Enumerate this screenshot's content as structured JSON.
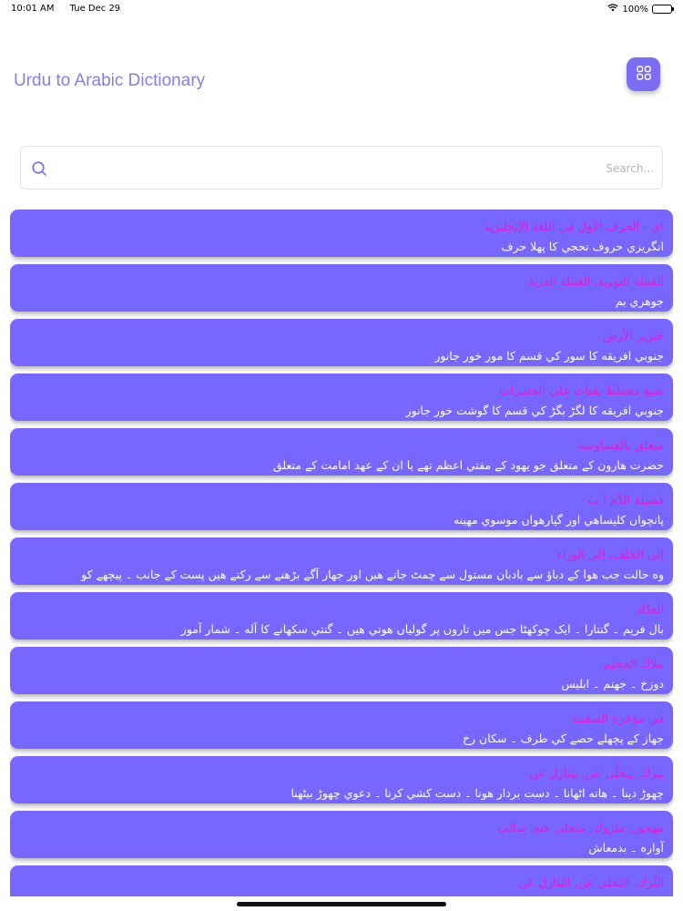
{
  "status_bar": {
    "time": "10:01 AM",
    "date": "Tue Dec 29",
    "battery": "100%",
    "wifi_icon": "wifi-icon",
    "battery_icon": "battery-icon"
  },
  "header": {
    "title": "Urdu to Arabic Dictionary",
    "menu_icon": "grid-icon"
  },
  "search": {
    "placeholder": "Search...",
    "value": "",
    "icon": "search-icon"
  },
  "colors": {
    "accent": "#7766ff",
    "arabic_text": "#e01fd0",
    "urdu_text": "#ffffff",
    "title": "#8a7cf0"
  },
  "entries": [
    {
      "arabic": "اي - الحرف الأول في اللغة الإنجليزية",
      "urdu": "انگريزي حروف تحجي کا پهلا حرف"
    },
    {
      "arabic": "القنبلة النووية, القنبلة الذرية",
      "urdu": "جوهري بم"
    },
    {
      "arabic": "خنزير الأرض",
      "urdu": "جنوبي افريقه کا سور کي قسم کا مور خور جانور"
    },
    {
      "arabic": "ضبع مخطط يقتات على الحشرات",
      "urdu": "جنوبي افريقه کا لگڑ بگڑ کي قسم کا گوشت خور جانور"
    },
    {
      "arabic": "متعلق بالقساوسة",
      "urdu": "حضرت هارون کے متعلق جو يهود کے مفتي اعظم تهے يا ان کے عهد امامت کے متعلق"
    },
    {
      "arabic": "فصيلة الدَّم ا ب",
      "urdu": "پانچواں کليساهي اور گيارهواں موسوي مهينه"
    },
    {
      "arabic": "إلى الخلف, إلى الوراء",
      "urdu": "وه حالت جب هوا کے دباؤ سے بادبان مستول سے چمٹ جاتے هيں اور جهاز آگے بڑهنے سے رکتے هيں پست کے جانب ۔ پيچهے کو"
    },
    {
      "arabic": "العدّاد",
      "urdu": "بال فريم ۔ گنتارا ۔ ايک چوکهٹا جس ميں تاروں پر گولياں هوتي هيں ۔ گنتي سکهانے کا آله ۔ شمار آموز"
    },
    {
      "arabic": "ملاك الجحيم",
      "urdu": "دوزخ ۔ جهنم ۔ ابليس"
    },
    {
      "arabic": "في مؤخرة السفينة",
      "urdu": "جهاز کے پچهلے حصے کي طرف ۔ سکان رخ"
    },
    {
      "arabic": "يترك, يتخلّى عن, يتنازل عن",
      "urdu": "چهوڑ دينا ۔ هاته اٹهانا ۔ دست بردار هونا ۔ دست کشي کرنا ۔ دعوي چهوڑ بيٹهنا"
    },
    {
      "arabic": "مهجور, متروك, متخلى عنه, سائب",
      "urdu": "آواره ۔ بدمعاش"
    },
    {
      "arabic": "التَّرك, التخلي عن, التنازل عن",
      "urdu": ""
    }
  ]
}
